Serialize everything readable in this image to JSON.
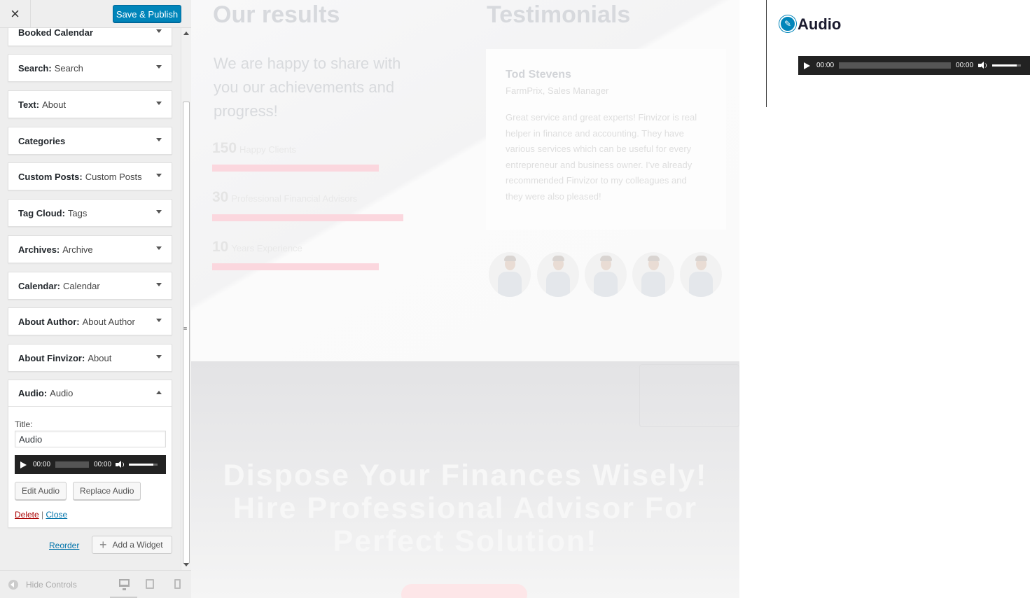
{
  "header": {
    "close_glyph": "×",
    "publish_label": "Save & Publish"
  },
  "widgets": [
    {
      "name": "Booked Calendar",
      "title": ""
    },
    {
      "name": "Search:",
      "title": "Search"
    },
    {
      "name": "Text:",
      "title": "About"
    },
    {
      "name": "Categories",
      "title": ""
    },
    {
      "name": "Custom Posts:",
      "title": "Custom Posts"
    },
    {
      "name": "Tag Cloud:",
      "title": "Tags"
    },
    {
      "name": "Archives:",
      "title": "Archive"
    },
    {
      "name": "Calendar:",
      "title": "Calendar"
    },
    {
      "name": "About Author:",
      "title": "About Author"
    },
    {
      "name": "About Finvizor:",
      "title": "About"
    }
  ],
  "audio_widget": {
    "name": "Audio:",
    "title": "Audio",
    "title_label": "Title:",
    "title_value": "Audio",
    "player": {
      "current_time": "00:00",
      "duration": "00:00",
      "volume": 0.8
    },
    "edit_label": "Edit Audio",
    "replace_label": "Replace Audio",
    "delete_label": "Delete",
    "separator": "|",
    "close_label": "Close"
  },
  "footer_actions": {
    "reorder_label": "Reorder",
    "add_widget_label": "Add a Widget"
  },
  "bottom_bar": {
    "hide_controls_label": "Hide Controls",
    "devices": [
      "desktop-icon",
      "tablet-icon",
      "mobile-icon"
    ]
  },
  "preview": {
    "results_title": "Our results",
    "results_subtitle": "We are happy to share with you our achievements and progress!",
    "stats": [
      {
        "number": "150",
        "label": "Happy Clients",
        "fill": 0.87
      },
      {
        "number": "30",
        "label": "Professional Financial Advisors",
        "fill": 1.0
      },
      {
        "number": "10",
        "label": "Years Experience",
        "fill": 0.87
      }
    ],
    "testimonials_title": "Testimonials",
    "testimonial": {
      "name": "Tod Stevens",
      "role": "FarmPrix, Sales Manager",
      "text": "Great service and great experts! Finvizor is real helper in finance and accounting. They have various services which can be useful for every entrepreneur and business owner. I've already recommended Finvizor to my colleagues and they were also pleased!"
    },
    "hero_title": "Dispose Your Finances Wisely! Hire Professional Advisor For Perfect Solution!"
  },
  "widget_preview": {
    "title": "Audio",
    "player": {
      "current_time": "00:00",
      "duration": "00:00",
      "volume": 0.8
    }
  },
  "colors": {
    "primary_button": "#0085ba",
    "delete_link": "#a00",
    "link": "#0073aa",
    "progress_bar": "#fbd7de",
    "player_bg": "#222"
  }
}
